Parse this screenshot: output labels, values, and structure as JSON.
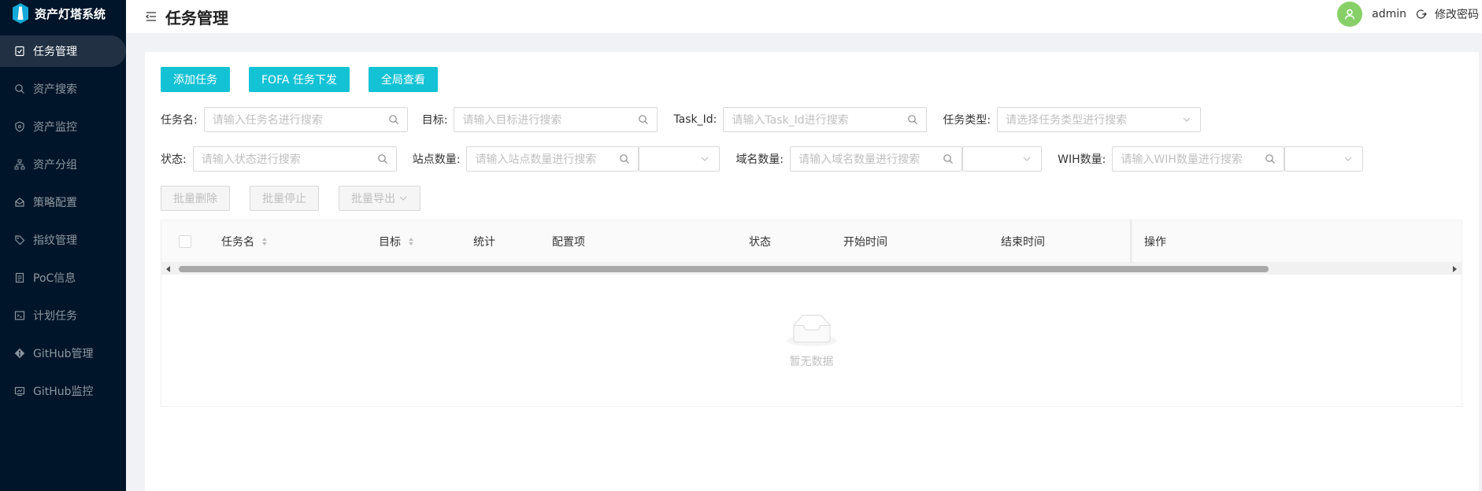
{
  "app": {
    "title": "资产灯塔系统"
  },
  "sidebar": {
    "items": [
      {
        "label": "任务管理",
        "icon": "task-icon",
        "active": true
      },
      {
        "label": "资产搜索",
        "icon": "search-icon",
        "active": false
      },
      {
        "label": "资产监控",
        "icon": "shield-icon",
        "active": false
      },
      {
        "label": "资产分组",
        "icon": "cluster-icon",
        "active": false
      },
      {
        "label": "策略配置",
        "icon": "gift-icon",
        "active": false
      },
      {
        "label": "指纹管理",
        "icon": "tag-icon",
        "active": false
      },
      {
        "label": "PoC信息",
        "icon": "file-icon",
        "active": false
      },
      {
        "label": "计划任务",
        "icon": "code-icon",
        "active": false
      },
      {
        "label": "GitHub管理",
        "icon": "git-icon",
        "active": false
      },
      {
        "label": "GitHub监控",
        "icon": "monitor-icon",
        "active": false
      }
    ]
  },
  "header": {
    "page_title": "任务管理",
    "username": "admin",
    "change_password": "修改密码"
  },
  "toolbar": {
    "add_task": "添加任务",
    "fofa_task": "FOFA 任务下发",
    "global_view": "全局查看"
  },
  "filters": {
    "task_name_label": "任务名:",
    "task_name_placeholder": "请输入任务名进行搜索",
    "target_label": "目标:",
    "target_placeholder": "请输入目标进行搜索",
    "task_id_label": "Task_Id:",
    "task_id_placeholder": "请输入Task_Id进行搜索",
    "task_type_label": "任务类型:",
    "task_type_placeholder": "请选择任务类型进行搜索",
    "status_label": "状态:",
    "status_placeholder": "请输入状态进行搜索",
    "site_count_label": "站点数量:",
    "site_count_placeholder": "请输入站点数量进行搜索",
    "domain_count_label": "域名数量:",
    "domain_count_placeholder": "请输入域名数量进行搜索",
    "wih_count_label": "WIH数量:",
    "wih_count_placeholder": "请输入WIH数量进行搜索"
  },
  "batch": {
    "delete": "批量删除",
    "stop": "批量停止",
    "export": "批量导出"
  },
  "table": {
    "columns": [
      "任务名",
      "目标",
      "统计",
      "配置项",
      "状态",
      "开始时间",
      "结束时间",
      "操作"
    ],
    "rows": [],
    "empty_text": "暂无数据"
  },
  "colors": {
    "primary": "#13c2d5",
    "sidebar_bg": "#001529",
    "avatar_bg": "#87d068"
  }
}
